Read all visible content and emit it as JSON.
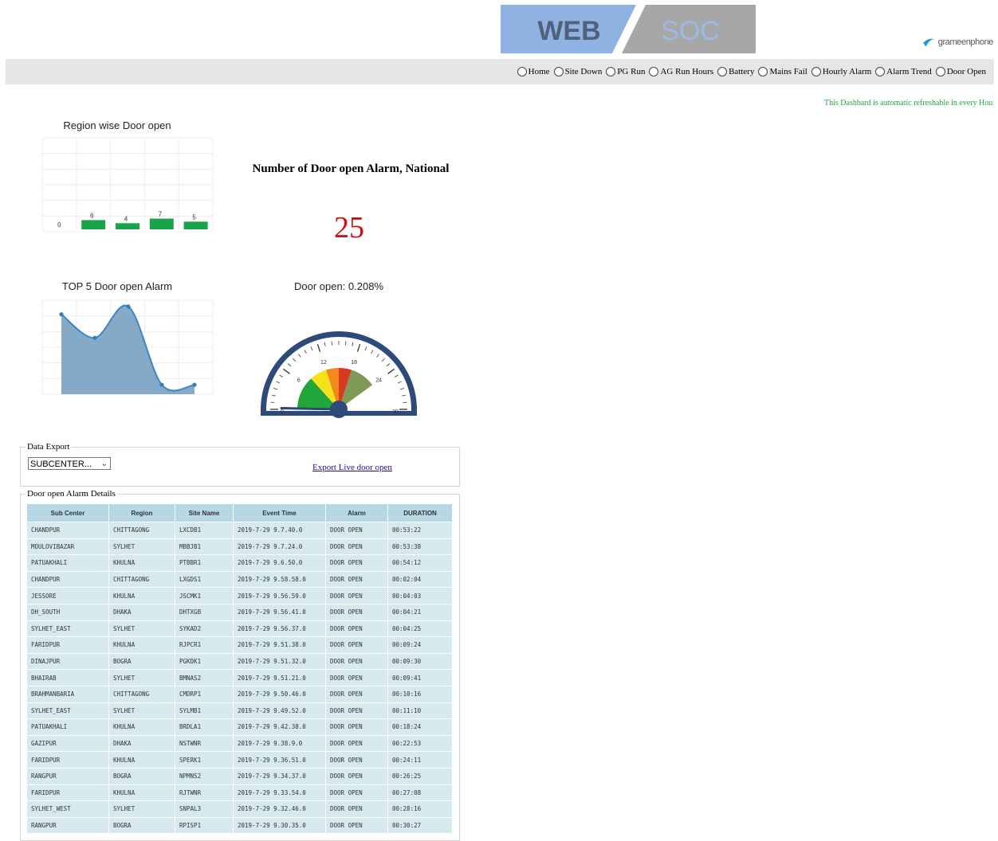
{
  "header": {
    "logo_left": "WEB",
    "logo_right": "SOC",
    "brand": "grameenphone",
    "nav": [
      "Home",
      "Site Down",
      "PG Run",
      "AG Run Hours",
      "Battery",
      "Mains Fail",
      "Hourly Alarm",
      "Alarm Trend",
      "Door Open"
    ],
    "refresh_note": "This Dashbard is automatic refreshable in every Hou"
  },
  "colors": {
    "logo_web_bg": "#8fb2e3",
    "logo_soc_bg": "#a7a7a7",
    "bar_green": "#19a34a",
    "area_fill": "#7fa4c4",
    "alarm_number": "#d01010",
    "table_header": "#b6d8e4",
    "table_cell": "#d6e9ee"
  },
  "region_chart": {
    "title": "Region wise Door open",
    "chart_data": {
      "type": "bar",
      "categories": [
        "",
        "",
        "",
        "",
        ""
      ],
      "values": [
        0,
        6,
        4,
        7,
        5
      ]
    }
  },
  "national": {
    "title": "Number of Door open Alarm, National",
    "count": "25"
  },
  "top5_chart": {
    "title": "TOP 5 Door open Alarm",
    "chart_data": {
      "type": "area",
      "x": [
        1,
        2,
        3,
        4,
        5
      ],
      "values": [
        5.1,
        3.6,
        5.6,
        0.6,
        0.6
      ],
      "ylim": [
        0,
        6
      ]
    }
  },
  "gauge": {
    "title": "Door open: 0.208%",
    "value": 0.2,
    "min": 0,
    "max": 30,
    "tick_labels": [
      "0",
      "6",
      "12",
      "18",
      "24",
      "30"
    ]
  },
  "export": {
    "legend": "Data Export",
    "select_value": "SUBCENTER...",
    "link_text": "Export Live door open"
  },
  "details": {
    "legend": "Door open Alarm Details",
    "columns": [
      "Sub Center",
      "Region",
      "Site Name",
      "Event Time",
      "Alarm",
      "DURATION"
    ],
    "rows": [
      [
        "CHANDPUR",
        "CHITTAGONG",
        "LXCDB1",
        "2019-7-29 9.7.40.0",
        "DOOR OPEN",
        "00:53:22"
      ],
      [
        "MOULOVIBAZAR",
        "SYLHET",
        "MBBJB1",
        "2019-7-29 9.7.24.0",
        "DOOR OPEN",
        "00:53:38"
      ],
      [
        "PATUAKHALI",
        "KHULNA",
        "PTBBR1",
        "2019-7-29 9.6.50.0",
        "DOOR OPEN",
        "00:54:12"
      ],
      [
        "CHANDPUR",
        "CHITTAGONG",
        "LXGDS1",
        "2019-7-29 9.58.58.0",
        "DOOR OPEN",
        "00:02:04"
      ],
      [
        "JESSORE",
        "KHULNA",
        "JSCMK1",
        "2019-7-29 9.56.59.0",
        "DOOR OPEN",
        "00:04:03"
      ],
      [
        "DH_SOUTH",
        "DHAKA",
        "DHTXGB",
        "2019-7-29 9.56.41.0",
        "DOOR OPEN",
        "00:04:21"
      ],
      [
        "SYLHET_EAST",
        "SYLHET",
        "SYKAD2",
        "2019-7-29 9.56.37.0",
        "DOOR OPEN",
        "00:04:25"
      ],
      [
        "FARIDPUR",
        "KHULNA",
        "RJPCR1",
        "2019-7-29 9.51.38.0",
        "DOOR OPEN",
        "00:09:24"
      ],
      [
        "DINAJPUR",
        "BOGRA",
        "PGKDK1",
        "2019-7-29 9.51.32.0",
        "DOOR OPEN",
        "00:09:30"
      ],
      [
        "BHAIRAB",
        "SYLHET",
        "BMNAS2",
        "2019-7-29 9.51.21.0",
        "DOOR OPEN",
        "00:09:41"
      ],
      [
        "BRAHMANBARIA",
        "CHITTAGONG",
        "CMDRP1",
        "2019-7-29 9.50.46.0",
        "DOOR OPEN",
        "00:10:16"
      ],
      [
        "SYLHET_EAST",
        "SYLHET",
        "SYLMB1",
        "2019-7-29 9.49.52.0",
        "DOOR OPEN",
        "00:11:10"
      ],
      [
        "PATUAKHALI",
        "KHULNA",
        "BRDLA1",
        "2019-7-29 9.42.38.0",
        "DOOR OPEN",
        "00:18:24"
      ],
      [
        "GAZIPUR",
        "DHAKA",
        "NSTWNR",
        "2019-7-29 9.38.9.0",
        "DOOR OPEN",
        "00:22:53"
      ],
      [
        "FARIDPUR",
        "KHULNA",
        "SPERK1",
        "2019-7-29 9.36.51.0",
        "DOOR OPEN",
        "00:24:11"
      ],
      [
        "RANGPUR",
        "BOGRA",
        "NPMNS2",
        "2019-7-29 9.34.37.0",
        "DOOR OPEN",
        "00:26:25"
      ],
      [
        "FARIDPUR",
        "KHULNA",
        "RJTWNR",
        "2019-7-29 9.33.54.0",
        "DOOR OPEN",
        "00:27:08"
      ],
      [
        "SYLHET_WEST",
        "SYLHET",
        "SNPAL3",
        "2019-7-29 9.32.46.0",
        "DOOR OPEN",
        "00:28:16"
      ],
      [
        "RANGPUR",
        "BOGRA",
        "RPISP1",
        "2019-7-29 9.30.35.0",
        "DOOR OPEN",
        "00:30:27"
      ]
    ]
  }
}
